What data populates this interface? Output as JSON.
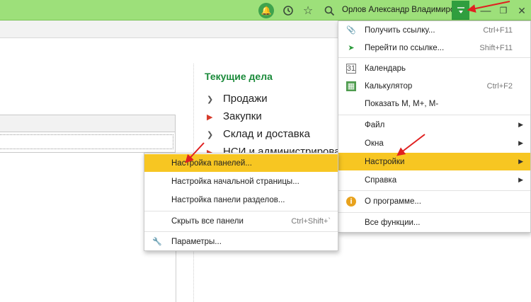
{
  "titlebar": {
    "user_name": "Орлов Александр Владимирович",
    "icons": [
      "bell-icon",
      "history-icon",
      "star-icon",
      "search-icon",
      "menu-icon",
      "minimize-icon",
      "maximize-icon",
      "close-icon"
    ],
    "accent_color": "#9de07a"
  },
  "sections": {
    "title": "Текущие дела",
    "items": [
      {
        "label": "Продажи"
      },
      {
        "label": "Закупки"
      },
      {
        "label": "Склад и доставка"
      },
      {
        "label": "НСИ и администрирование"
      }
    ]
  },
  "main_menu": {
    "items": [
      {
        "label": "Получить ссылку...",
        "shortcut": "Ctrl+F11",
        "icon": "link-icon"
      },
      {
        "label": "Перейти по ссылке...",
        "shortcut": "Shift+F11",
        "icon": "go-link-icon"
      },
      {
        "label": "Календарь",
        "icon": "calendar-icon",
        "icon_text": "31"
      },
      {
        "label": "Калькулятор",
        "shortcut": "Ctrl+F2",
        "icon": "calculator-icon"
      },
      {
        "label": "Показать M, M+, M-"
      },
      {
        "label": "Файл"
      },
      {
        "label": "Окна"
      },
      {
        "label": "Настройки"
      },
      {
        "label": "Справка"
      },
      {
        "label": "О программе...",
        "icon": "info-icon"
      },
      {
        "label": "Все функции..."
      }
    ],
    "highlight_color": "#f7c622"
  },
  "settings_submenu": {
    "items": [
      {
        "label": "Настройка панелей..."
      },
      {
        "label": "Настройка начальной страницы..."
      },
      {
        "label": "Настройка панели разделов..."
      },
      {
        "label": "Скрыть все панели",
        "shortcut": "Ctrl+Shift+`"
      },
      {
        "label": "Параметры...",
        "icon": "wrench-icon"
      }
    ]
  },
  "annotation_color": "#e02020"
}
